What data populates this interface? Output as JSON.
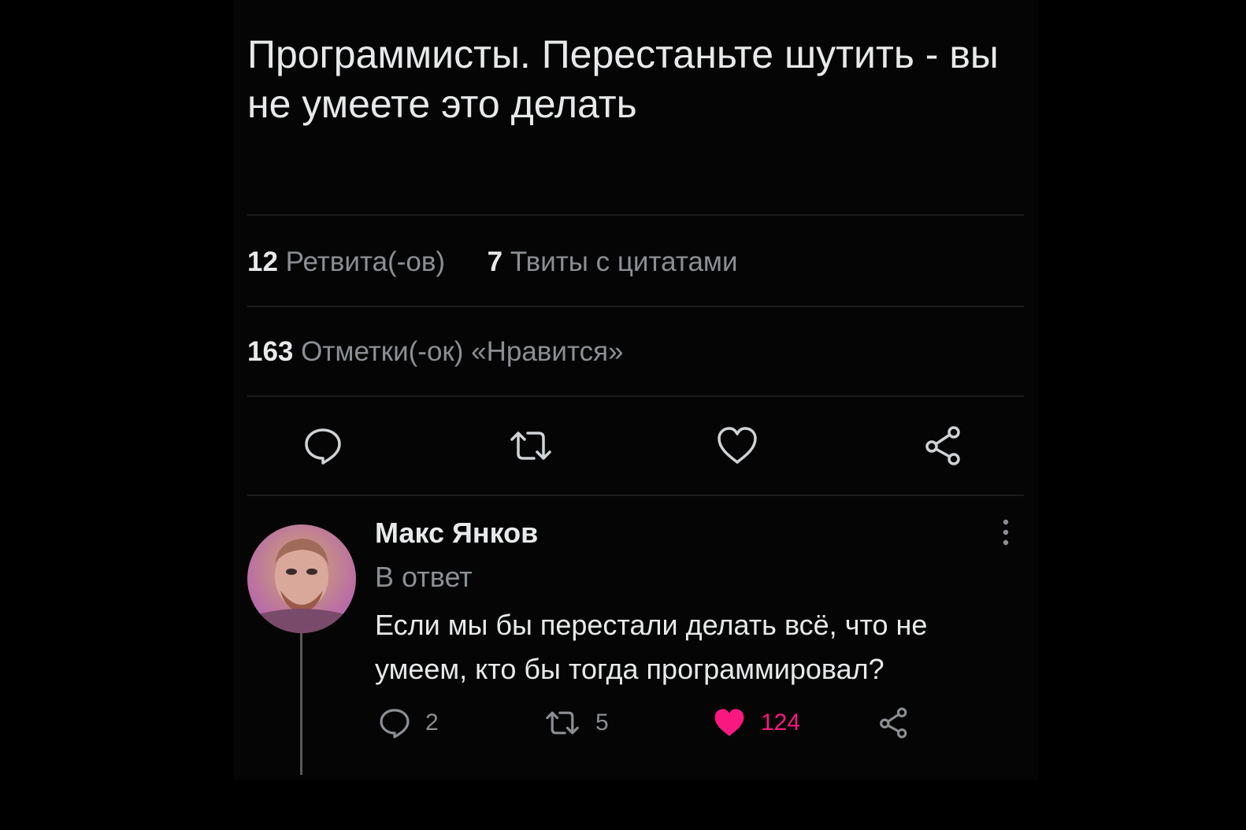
{
  "tweet": {
    "text": "Программисты. Перестаньте шутить - вы не умеете это делать"
  },
  "stats": {
    "retweets_count": "12",
    "retweets_label": "Ретвита(-ов)",
    "quotes_count": "7",
    "quotes_label": "Твиты с цитатами",
    "likes_count": "163",
    "likes_label": "Отметки(-ок) «Нравится»"
  },
  "actions": {
    "icons": [
      "reply-icon",
      "retweet-icon",
      "like-icon",
      "share-icon"
    ]
  },
  "reply": {
    "author_name": "Макс Янков",
    "subtitle": "В ответ",
    "text": "Если мы бы перестали делать всё, что не умеем, кто бы тогда программировал?",
    "replies_count": "2",
    "retweets_count": "5",
    "likes_count": "124",
    "liked": true
  },
  "colors": {
    "background": "#000000",
    "text_primary": "#e7e9ea",
    "text_secondary": "#8b8f94",
    "like_accent": "#f91880"
  }
}
